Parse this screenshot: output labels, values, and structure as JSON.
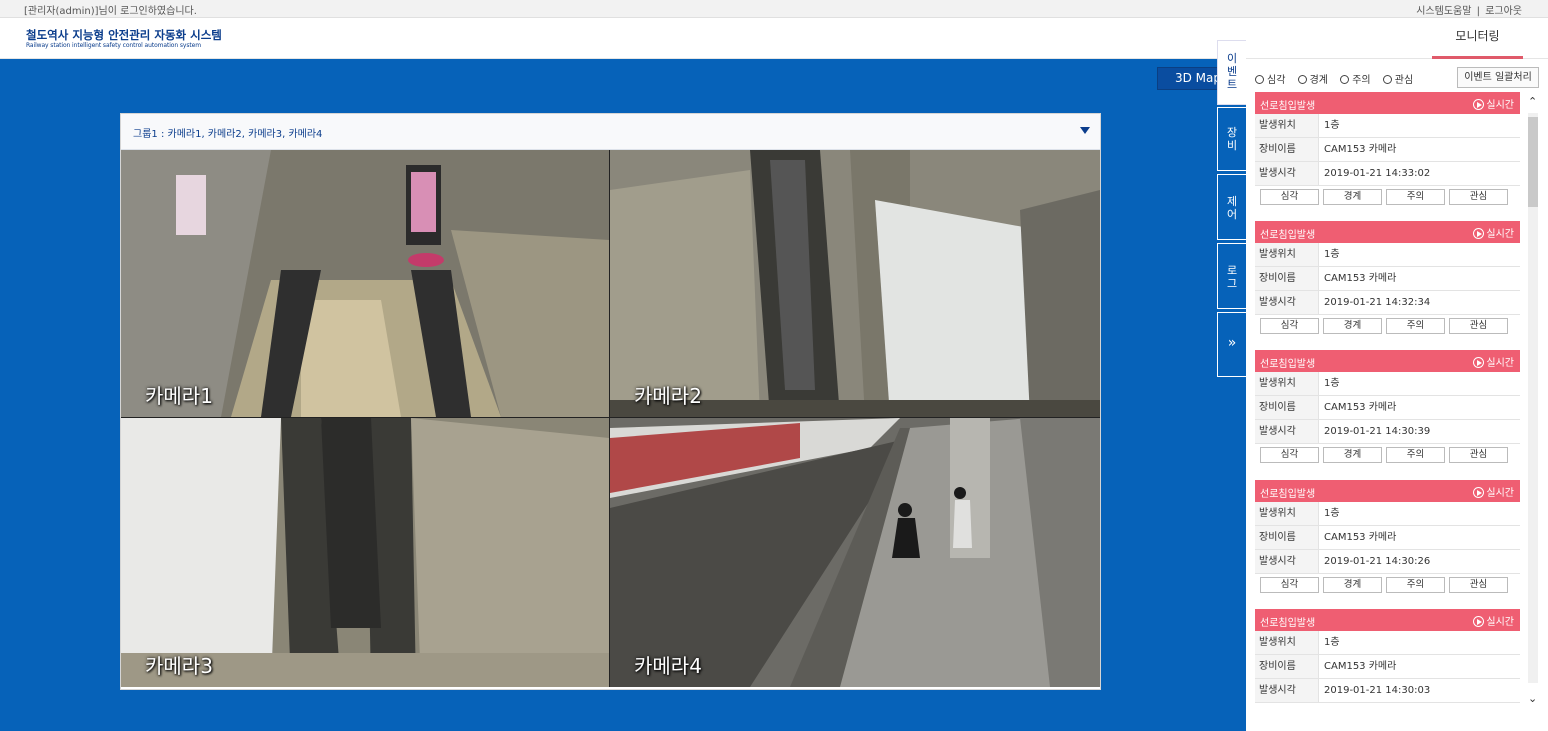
{
  "topbar": {
    "login_text": "[관리자(admin)]님이 로그인하였습니다.",
    "help_link": "시스템도움말",
    "separator": "|",
    "logout_link": "로그아웃"
  },
  "header": {
    "title": "철도역사 지능형 안전관리 자동화 시스템",
    "subtitle": "Railway station intelligent safety control automation system",
    "nav_tab": "모니터링"
  },
  "main": {
    "map_button": "3D Map",
    "group_title": "그룹1 : 카메라1, 카메라2, 카메라3, 카메라4",
    "cameras": [
      "카메라1",
      "카메라2",
      "카메라3",
      "카메라4"
    ]
  },
  "side_tabs": [
    {
      "label": [
        "이",
        "벤",
        "트"
      ],
      "active": true
    },
    {
      "label": [
        "장",
        "비"
      ],
      "active": false
    },
    {
      "label": [
        "제",
        "어"
      ],
      "active": false
    },
    {
      "label": [
        "로",
        "그"
      ],
      "active": false
    },
    {
      "label": [
        "»"
      ],
      "active": false
    }
  ],
  "event_panel": {
    "filters": [
      "심각",
      "경계",
      "주의",
      "관심"
    ],
    "bulk_button": "이벤트 일괄처리",
    "labels": {
      "location": "발생위치",
      "device": "장비이름",
      "time": "발생시각",
      "realtime": "실시간"
    },
    "action_buttons": [
      "심각",
      "경계",
      "주의",
      "관심"
    ],
    "events": [
      {
        "title": "선로침입발생",
        "location": "1층",
        "device": "CAM153 카메라",
        "time": "2019-01-21 14:33:02"
      },
      {
        "title": "선로침입발생",
        "location": "1층",
        "device": "CAM153 카메라",
        "time": "2019-01-21 14:32:34"
      },
      {
        "title": "선로침입발생",
        "location": "1층",
        "device": "CAM153 카메라",
        "time": "2019-01-21 14:30:39"
      },
      {
        "title": "선로침입발생",
        "location": "1층",
        "device": "CAM153 카메라",
        "time": "2019-01-21 14:30:26"
      },
      {
        "title": "선로침입발생",
        "location": "1층",
        "device": "CAM153 카메라",
        "time": "2019-01-21 14:30:03"
      }
    ]
  },
  "colors": {
    "main_blue": "#0662b9",
    "event_header": "#ef5e72",
    "nav_underline": "#e05a6a",
    "brand_navy": "#0b3d8c"
  }
}
